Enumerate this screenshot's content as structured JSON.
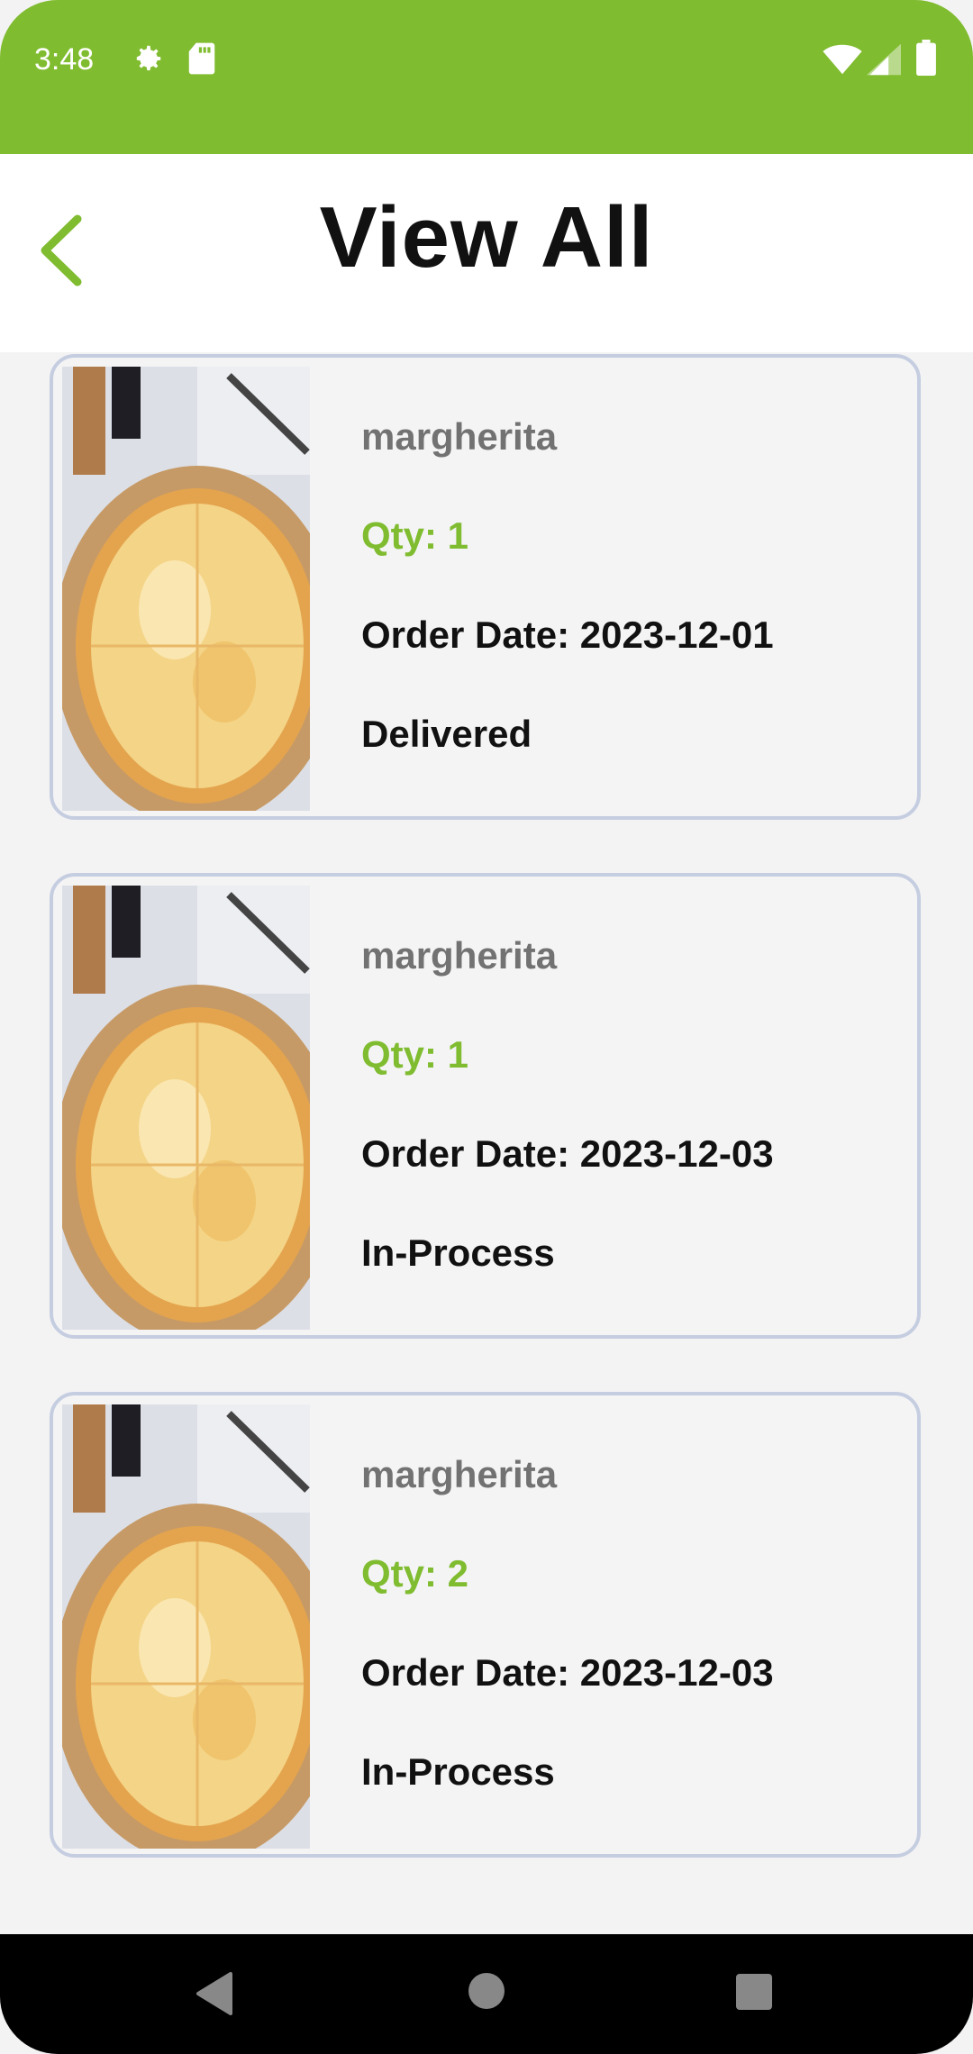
{
  "status_bar": {
    "time": "3:48",
    "icons": [
      "gear-icon",
      "sd-card-icon",
      "wifi-icon",
      "cell-signal-icon",
      "battery-icon"
    ]
  },
  "app_bar": {
    "title": "View All",
    "back_icon": "chevron-left-icon"
  },
  "colors": {
    "accent": "#80bc30",
    "card_border": "#c5cde0",
    "card_bg": "#f4f4f5",
    "name_text": "#727272"
  },
  "orders": [
    {
      "name": "margherita",
      "qty": "Qty: 1",
      "date": "Order Date: 2023-12-01",
      "status": "Delivered"
    },
    {
      "name": "margherita",
      "qty": "Qty: 1",
      "date": "Order Date: 2023-12-03",
      "status": "In-Process"
    },
    {
      "name": "margherita",
      "qty": "Qty: 2",
      "date": "Order Date: 2023-12-03",
      "status": "In-Process"
    }
  ],
  "nav_bar": {
    "icons": [
      "back-triangle-icon",
      "home-circle-icon",
      "recents-square-icon"
    ]
  }
}
